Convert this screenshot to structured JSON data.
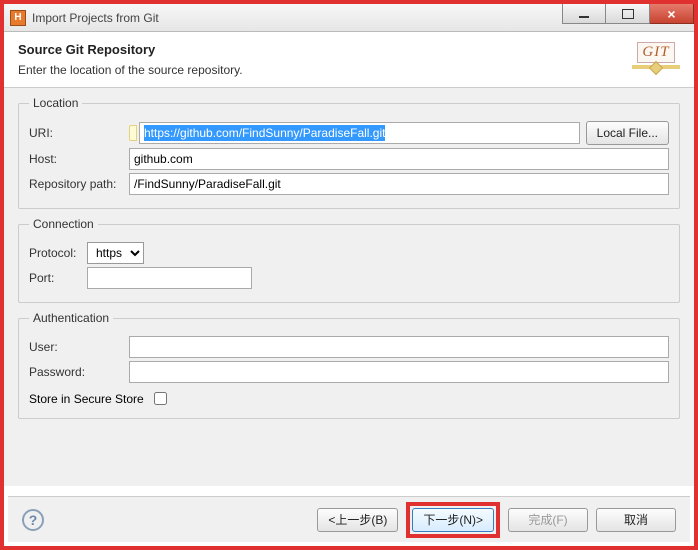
{
  "window": {
    "title": "Import Projects from Git"
  },
  "header": {
    "title": "Source Git Repository",
    "subtitle": "Enter the location of the source repository.",
    "icon_label": "GIT"
  },
  "location": {
    "legend": "Location",
    "uri_label": "URI:",
    "uri_value": "https://github.com/FindSunny/ParadiseFall.git",
    "local_file_btn": "Local File...",
    "host_label": "Host:",
    "host_value": "github.com",
    "repo_path_label": "Repository path:",
    "repo_path_value": "/FindSunny/ParadiseFall.git"
  },
  "connection": {
    "legend": "Connection",
    "protocol_label": "Protocol:",
    "protocol_value": "https",
    "port_label": "Port:",
    "port_value": ""
  },
  "authentication": {
    "legend": "Authentication",
    "user_label": "User:",
    "user_value": "",
    "password_label": "Password:",
    "password_value": "",
    "store_label": "Store in Secure Store"
  },
  "footer": {
    "back": "<上一步(B)",
    "next": "下一步(N)>",
    "finish": "完成(F)",
    "cancel": "取消"
  }
}
